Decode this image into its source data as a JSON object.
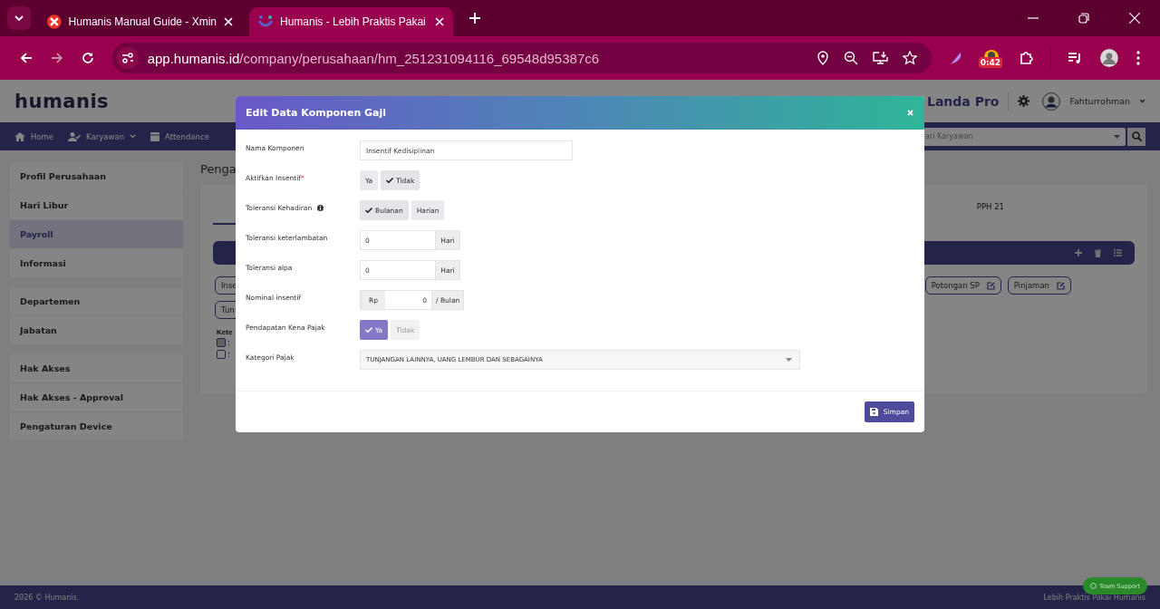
{
  "browser": {
    "tabs": [
      {
        "title": "Humanis Manual Guide - Xmin",
        "selected": false
      },
      {
        "title": "Humanis - Lebih Praktis Pakai",
        "selected": true
      }
    ],
    "url_host": "app.humanis.id",
    "url_path": "/company/perusahaan/hm_251231094116_69548d95387c6",
    "extension_badge": "0:42"
  },
  "header": {
    "logo": "humanis",
    "plan": "Landa Pro",
    "user": "Fahturrohman"
  },
  "nav": {
    "items": [
      {
        "label": "Home",
        "dropdown": false
      },
      {
        "label": "Karyawan",
        "dropdown": true
      },
      {
        "label": "Attendance",
        "dropdown": false
      }
    ],
    "search_placeholder": "ari Karyawan"
  },
  "sidebar": {
    "groups": [
      [
        {
          "label": "Profil Perusahaan",
          "selected": false
        },
        {
          "label": "Hari Libur",
          "selected": false
        },
        {
          "label": "Payroll",
          "selected": true
        },
        {
          "label": "Informasi",
          "selected": false
        }
      ],
      [
        {
          "label": "Departemen",
          "selected": false
        },
        {
          "label": "Jabatan",
          "selected": false
        }
      ],
      [
        {
          "label": "Hak Akses",
          "selected": false
        },
        {
          "label": "Hak Akses - Approval",
          "selected": false
        },
        {
          "label": "Pengaturan Device",
          "selected": false
        }
      ]
    ]
  },
  "main": {
    "heading": "Penga",
    "tab_label": "PPH 21",
    "chip_rows": [
      [
        {
          "label": "Inse",
          "edit": false
        },
        {
          "label": "Potongan SP",
          "edit": true
        },
        {
          "label": "Pinjaman",
          "edit": true
        }
      ],
      [
        {
          "label": "Tun",
          "edit": false
        }
      ]
    ],
    "legend": {
      "title": "Kete",
      "items": [
        {
          "text": ":",
          "filled": true
        },
        {
          "text": ":",
          "filled": false
        }
      ]
    }
  },
  "modal": {
    "title": "Edit Data Komponen Gaji",
    "fields": [
      {
        "kind": "text",
        "label": "Nama Komponen",
        "value": "Insentif Kedisiplinan"
      },
      {
        "kind": "toggle",
        "label": "Aktifkan Insentif",
        "required_mark": "*",
        "highlight": false,
        "options": [
          {
            "label": "Ya",
            "selected": false
          },
          {
            "label": "Tidak",
            "selected": true
          }
        ]
      },
      {
        "kind": "toggle",
        "label": "Toleransi Kehadiran",
        "info": true,
        "highlight": false,
        "options": [
          {
            "label": "Bulanan",
            "selected": true
          },
          {
            "label": "Harian",
            "selected": false
          }
        ]
      },
      {
        "kind": "addon",
        "label": "Toleransi keterlambatan",
        "value": "0",
        "suffix": "Hari"
      },
      {
        "kind": "addon",
        "label": "Toleransi alpa",
        "value": "0",
        "suffix": "Hari"
      },
      {
        "kind": "addon",
        "label": "Nominal insentif",
        "prefix": "Rp",
        "value": "0",
        "suffix": "/ Bulan"
      },
      {
        "kind": "toggle",
        "label": "Pendapatan Kena Pajak",
        "highlight": true,
        "options": [
          {
            "label": "Ya",
            "selected": true
          },
          {
            "label": "Tidak",
            "selected": false
          }
        ]
      },
      {
        "kind": "select",
        "label": "Kategori Pajak",
        "value": "TUNJANGAN LAINNYA, UANG LEMBUR DAN SEBAGAINYA"
      }
    ],
    "save_label": "Simpan"
  },
  "footer": {
    "left": "2026 © Humanis.",
    "right": "Lebih Praktis Pakai Humanis",
    "support": "Team Support"
  }
}
